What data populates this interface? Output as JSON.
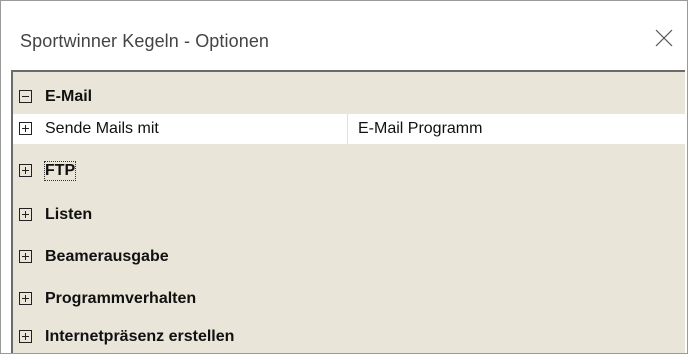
{
  "window": {
    "title": "Sportwinner Kegeln - Optionen"
  },
  "grid": {
    "categories": [
      {
        "label": "E-Mail",
        "expanded": true,
        "expander_icon": "minus-box-icon",
        "properties": [
          {
            "label": "Sende Mails mit",
            "value": "E-Mail Programm",
            "expander_icon": "plus-box-icon"
          }
        ]
      },
      {
        "label": "FTP",
        "expanded": false,
        "expander_icon": "plus-box-icon"
      },
      {
        "label": "Listen",
        "expanded": false,
        "expander_icon": "plus-box-icon"
      },
      {
        "label": "Beamerausgabe",
        "expanded": false,
        "expander_icon": "plus-box-icon"
      },
      {
        "label": "Programmverhalten",
        "expanded": false,
        "expander_icon": "plus-box-icon"
      },
      {
        "label": "Internetpräsenz erstellen",
        "expanded": false,
        "expander_icon": "plus-box-icon"
      }
    ]
  },
  "colors": {
    "grid_background": "#e9e5d9",
    "property_row_background": "#ffffff",
    "border": "#6b6b6b"
  }
}
